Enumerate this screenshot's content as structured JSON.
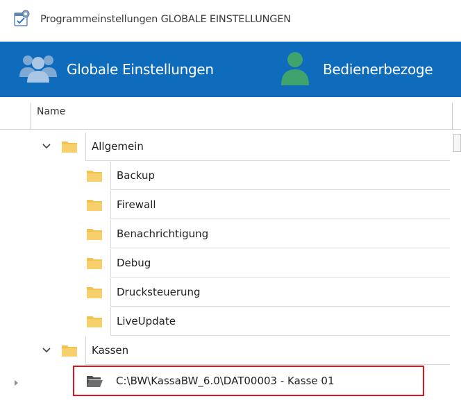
{
  "window": {
    "title": "Programmeinstellungen GLOBALE EINSTELLUNGEN",
    "icon": "settings-window-icon"
  },
  "ribbon": {
    "background": "#0f6cbd",
    "tabs": [
      {
        "label": "Globale Einstellungen",
        "icon": "users-group-icon",
        "selected": true
      },
      {
        "label": "Bedienerbezoge",
        "icon": "user-icon",
        "selected": false
      }
    ]
  },
  "grid": {
    "column_header": "Name",
    "rows": [
      {
        "label": "Allgemein",
        "level": 0,
        "expanded": true,
        "icon": "folder-icon"
      },
      {
        "label": "Backup",
        "level": 1,
        "icon": "folder-icon"
      },
      {
        "label": "Firewall",
        "level": 1,
        "icon": "folder-icon"
      },
      {
        "label": "Benachrichtigung",
        "level": 1,
        "icon": "folder-icon"
      },
      {
        "label": "Debug",
        "level": 1,
        "icon": "folder-icon"
      },
      {
        "label": "Drucksteuerung",
        "level": 1,
        "icon": "folder-icon"
      },
      {
        "label": "LiveUpdate",
        "level": 1,
        "icon": "folder-icon"
      },
      {
        "label": "Kassen",
        "level": 0,
        "expanded": true,
        "icon": "folder-icon"
      },
      {
        "label": "C:\\BW\\KassaBW_6.0\\DAT00003 - Kasse 01",
        "level": 1,
        "icon": "folder-open-icon",
        "current": true,
        "highlighted": true
      }
    ]
  },
  "colors": {
    "folder": "#f2c14e",
    "folder_dark": "#e0a626",
    "highlight_border": "#e0121a"
  }
}
